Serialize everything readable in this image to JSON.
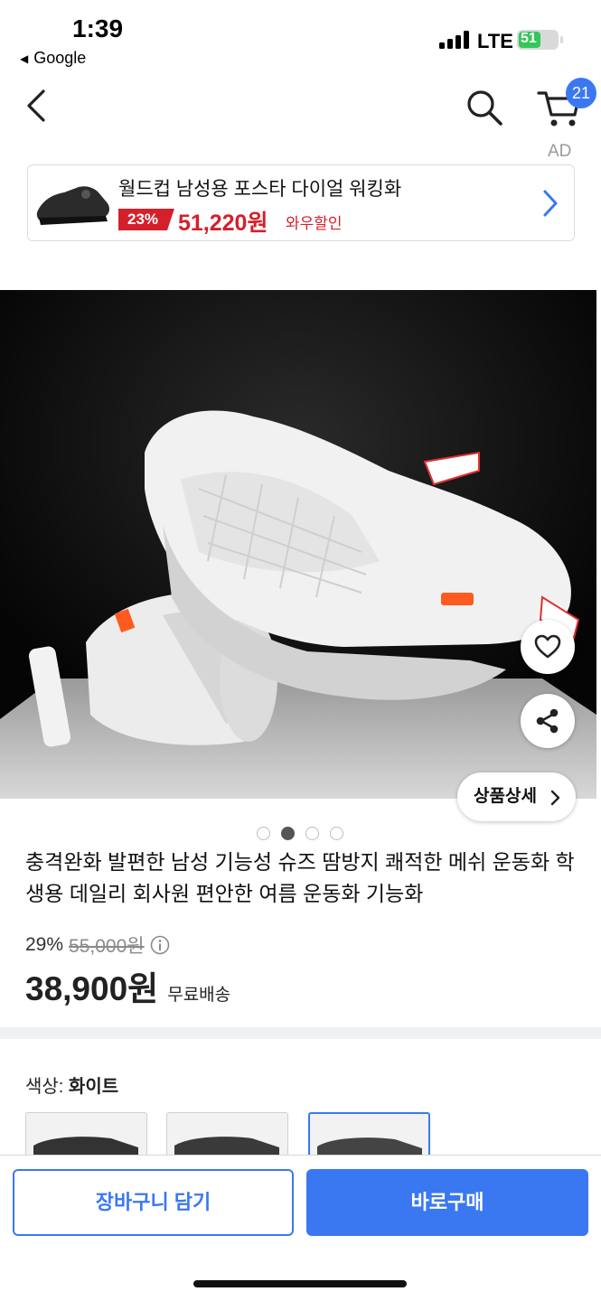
{
  "status_bar": {
    "time": "1:39",
    "back_app": "Google",
    "network": "LTE",
    "battery": "51"
  },
  "header": {
    "cart_count": "21",
    "ad_label": "AD"
  },
  "ad_banner": {
    "title": "월드컵 남성용 포스타 다이얼 워킹화",
    "discount": "23%",
    "price": "51,220원",
    "promo": "와우할인"
  },
  "product": {
    "detail_button": "상품상세",
    "title": "충격완화 발편한 남성 기능성 슈즈 땀방지 쾌적한 메쉬 운동화 학생용 데일리 회사원 편안한 여름 운동화 기능화",
    "discount": "29%",
    "original_price": "55,000원",
    "final_price": "38,900원",
    "shipping": "무료배송",
    "image_count": 4,
    "current_image": 2
  },
  "options": {
    "color_label": "색상:",
    "color_value": "화이트"
  },
  "actions": {
    "add_to_cart": "장바구니 담기",
    "buy_now": "바로구매"
  },
  "colors": {
    "accent": "#3a78f2",
    "sale_red": "#d4202b"
  }
}
